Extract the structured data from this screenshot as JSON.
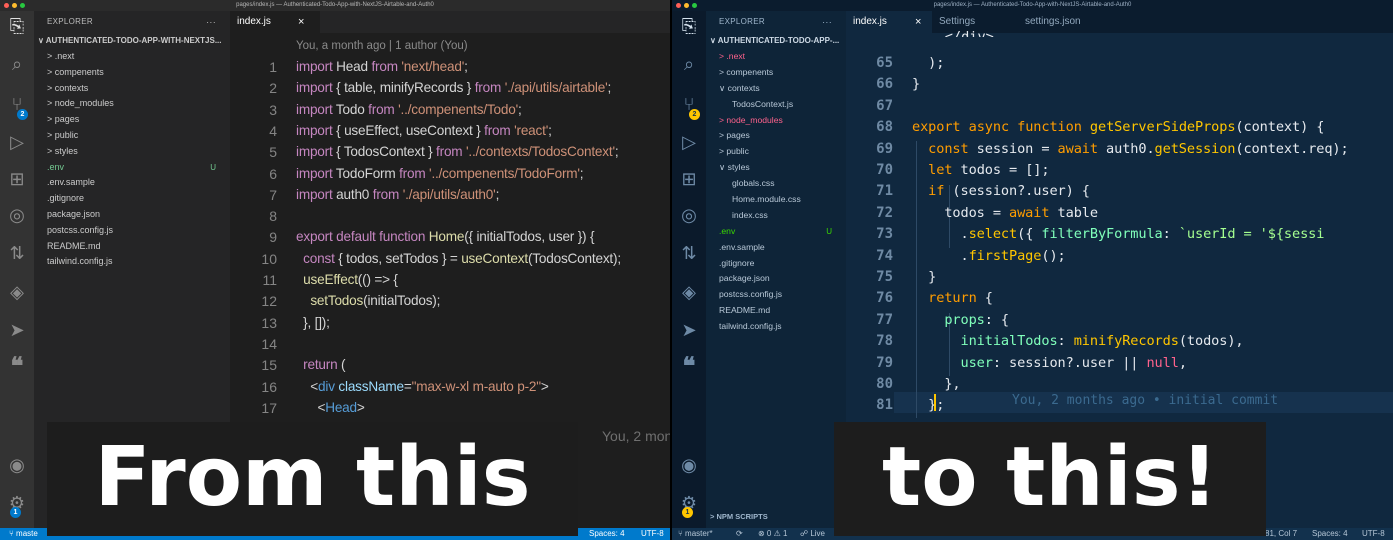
{
  "left": {
    "window_title": "pages/index.js — Authenticated-Todo-App-with-NextJS-Airtable-and-Auth0",
    "explorer_label": "EXPLORER",
    "explorer_more": "···",
    "root_folder": "AUTHENTICATED-TODO-APP-WITH-NEXTJS...",
    "tree": [
      {
        "label": "> .next",
        "badge": ""
      },
      {
        "label": "> compenents",
        "badge": ""
      },
      {
        "label": "> contexts",
        "badge": ""
      },
      {
        "label": "> node_modules",
        "badge": ""
      },
      {
        "label": "> pages",
        "badge": ""
      },
      {
        "label": "> public",
        "badge": ""
      },
      {
        "label": "> styles",
        "badge": ""
      },
      {
        "label": ".env",
        "badge": "U"
      },
      {
        "label": ".env.sample",
        "badge": ""
      },
      {
        "label": ".gitignore",
        "badge": ""
      },
      {
        "label": "package.json",
        "badge": ""
      },
      {
        "label": "postcss.config.js",
        "badge": ""
      },
      {
        "label": "README.md",
        "badge": ""
      },
      {
        "label": "tailwind.config.js",
        "badge": ""
      }
    ],
    "tab_label": "index.js",
    "tab_close": "×",
    "blame_header": "You, a month ago | 1 author (You)",
    "line_numbers": [
      "1",
      "2",
      "3",
      "4",
      "5",
      "6",
      "7",
      "8",
      "9",
      "10",
      "11",
      "12",
      "13",
      "14",
      "15",
      "16",
      "17"
    ],
    "code_lines": [
      "import Head from 'next/head';",
      "import { table, minifyRecords } from './api/utils/airtable';",
      "import Todo from '../compenents/Todo';",
      "import { useEffect, useContext } from 'react';",
      "import { TodosContext } from '../contexts/TodosContext';",
      "import TodoForm from '../compenents/TodoForm';",
      "import auth0 from './api/utils/auth0';",
      "",
      "export default function Home({ initialTodos, user }) {",
      "  const { todos, setTodos } = useContext(TodosContext);",
      "  useEffect(() => {",
      "    setTodos(initialTodos);",
      "  }, []);",
      "",
      "  return (",
      "    <div className=\"max-w-xl m-auto p-2\">",
      "      <Head>"
    ],
    "blame_inline": "You, 2 mon",
    "status_branch": "maste",
    "status_spaces": "Spaces: 4",
    "status_encoding": "UTF-8",
    "scm_badge": "2",
    "settings_badge": "1",
    "overlay_text": "From this"
  },
  "right": {
    "window_title": "pages/index.js — Authenticated-Todo-App-with-NextJS-Airtable-and-Auth0",
    "explorer_label": "EXPLORER",
    "explorer_more": "···",
    "root_folder": "AUTHENTICATED-TODO-APP-...",
    "tree": [
      {
        "label": "> .next",
        "badge": "",
        "color": "#ff628c"
      },
      {
        "label": "> compenents",
        "badge": "",
        "color": ""
      },
      {
        "label": "∨ contexts",
        "badge": "",
        "color": ""
      },
      {
        "label": "TodosContext.js",
        "badge": "",
        "color": "",
        "indent": true
      },
      {
        "label": "> node_modules",
        "badge": "",
        "color": "#ff628c"
      },
      {
        "label": "> pages",
        "badge": "",
        "color": ""
      },
      {
        "label": "> public",
        "badge": "",
        "color": ""
      },
      {
        "label": "∨ styles",
        "badge": "",
        "color": ""
      },
      {
        "label": "globals.css",
        "badge": "",
        "color": "",
        "indent": true
      },
      {
        "label": "Home.module.css",
        "badge": "",
        "color": "",
        "indent": true
      },
      {
        "label": "index.css",
        "badge": "",
        "color": "",
        "indent": true
      },
      {
        "label": ".env",
        "badge": "U",
        "color": "#3ad900"
      },
      {
        "label": ".env.sample",
        "badge": "",
        "color": ""
      },
      {
        "label": ".gitignore",
        "badge": "",
        "color": ""
      },
      {
        "label": "package.json",
        "badge": "",
        "color": ""
      },
      {
        "label": "postcss.config.js",
        "badge": "",
        "color": ""
      },
      {
        "label": "README.md",
        "badge": "",
        "color": ""
      },
      {
        "label": "tailwind.config.js",
        "badge": "",
        "color": ""
      }
    ],
    "npm_scripts": "> NPM SCRIPTS",
    "tabs": [
      "index.js",
      "Settings",
      "settings.json"
    ],
    "tab_close": "×",
    "partial_top": "    </div>",
    "line_numbers": [
      "65",
      "66",
      "67",
      "68",
      "69",
      "70",
      "71",
      "72",
      "73",
      "74",
      "75",
      "76",
      "77",
      "78",
      "79",
      "80",
      "81"
    ],
    "code_lines": [
      "  );",
      "}",
      "",
      "export async function getServerSideProps(context) {",
      "  const session = await auth0.getSession(context.req);",
      "  let todos = [];",
      "  if (session?.user) {",
      "    todos = await table",
      "      .select({ filterByFormula: `userId = '${sessi",
      "      .firstPage();",
      "  }",
      "  return {",
      "    props: {",
      "      initialTodos: minifyRecords(todos),",
      "      user: session?.user || null,",
      "    },",
      "  };"
    ],
    "blame_inline": "You, 2 months ago • initial commit",
    "status_branch": "master*",
    "status_sync": "⟳",
    "status_problems": "⊗ 0 ⚠ 1",
    "status_live": "Live",
    "status_position": "81, Col 7",
    "status_spaces": "Spaces: 4",
    "status_encoding": "UTF-8",
    "scm_badge": "2",
    "settings_badge": "1",
    "overlay_text": "to this!"
  }
}
